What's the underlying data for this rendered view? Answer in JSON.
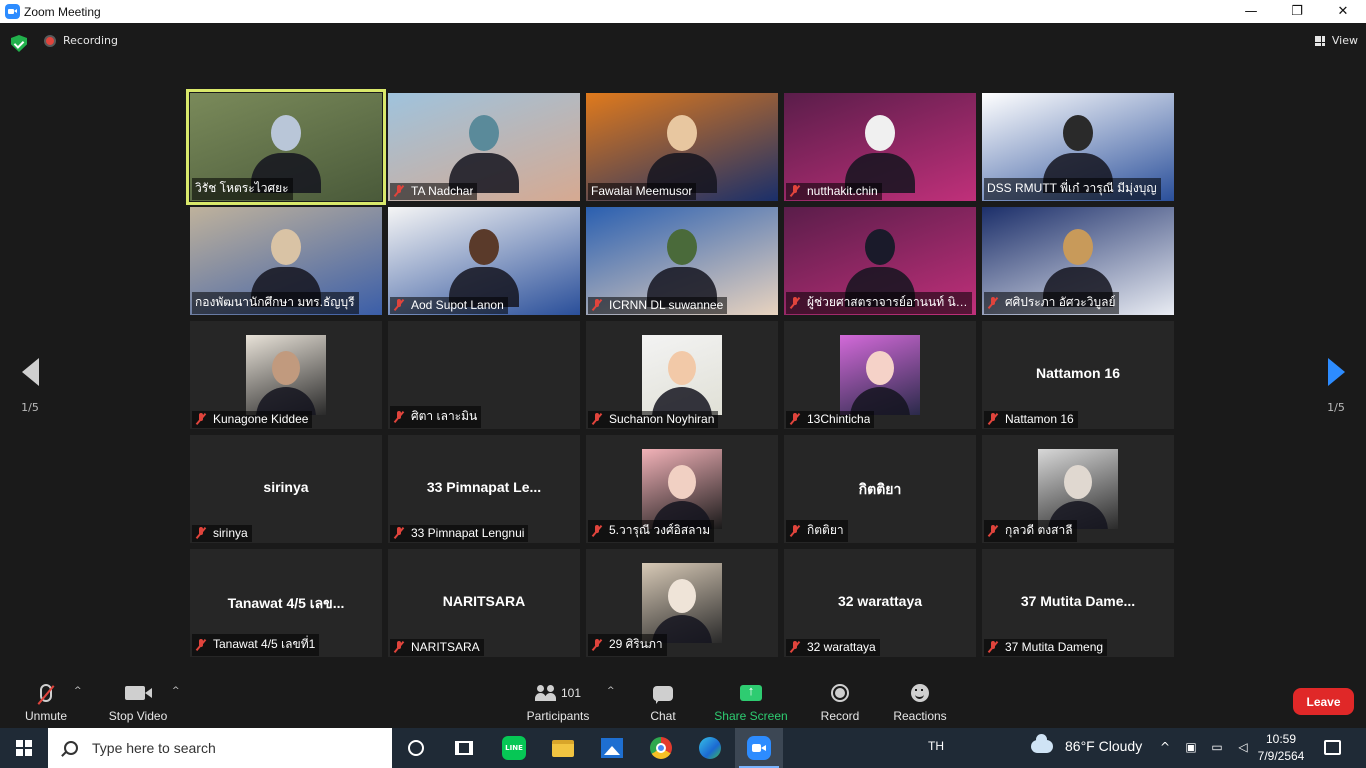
{
  "window": {
    "title": "Zoom Meeting",
    "minimize": "—",
    "restore": "❐",
    "close": "✕"
  },
  "topbar": {
    "recording_label": "Recording",
    "view_label": "View"
  },
  "paging": {
    "prev_label": "1/5",
    "next_label": "1/5"
  },
  "colors": {
    "accent": "#2d8cff",
    "active_speaker": "#d9e86b",
    "leave": "#e02828",
    "share": "#2ecc71",
    "muted": "#e0443c"
  },
  "participants": [
    {
      "name": "วิรัช  โหตระไวศยะ",
      "muted": false,
      "kind": "video",
      "palette": [
        "#7a8a5a",
        "#4a5a3a",
        "#b9c6d8"
      ],
      "active": true
    },
    {
      "name": "TA Nadchar",
      "muted": true,
      "kind": "video",
      "palette": [
        "#9fc3dd",
        "#d6a991",
        "#5a8a9a"
      ]
    },
    {
      "name": "Fawalai Meemusor",
      "muted": false,
      "kind": "video",
      "palette": [
        "#e07a1c",
        "#1a2f6a",
        "#e8c7a0"
      ]
    },
    {
      "name": "nutthakit.chin",
      "muted": true,
      "kind": "video",
      "palette": [
        "#5a1d4a",
        "#c0307a",
        "#f0f0f0"
      ]
    },
    {
      "name": "DSS RMUTT พี่เก๋ วารุณี มีมุ่งบุญ",
      "muted": false,
      "kind": "video",
      "palette": [
        "#ffffff",
        "#2a4f9a",
        "#2a2a2a"
      ]
    },
    {
      "name": "กองพัฒนานักศึกษา มทร.ธัญบุรี",
      "muted": false,
      "kind": "video",
      "palette": [
        "#bfb29c",
        "#3b5ea8",
        "#d9c3a5"
      ]
    },
    {
      "name": "Aod Supot Lanon",
      "muted": true,
      "kind": "video",
      "palette": [
        "#f5f5f5",
        "#2a4f9a",
        "#5a3a2a"
      ]
    },
    {
      "name": "ICRNN DL suwannee",
      "muted": true,
      "kind": "video",
      "palette": [
        "#2a5fb0",
        "#e8d3bf",
        "#4a6a3a"
      ]
    },
    {
      "name": "ผู้ช่วยศาสตราจารย์อานนท์ นิยม...",
      "muted": true,
      "kind": "video",
      "palette": [
        "#5a1d4a",
        "#c0307a",
        "#1a1a2a"
      ]
    },
    {
      "name": "ศศิประภา อัศวะวิบูลย์",
      "muted": true,
      "kind": "video",
      "palette": [
        "#1c2f6a",
        "#e9ecf3",
        "#c89a5a"
      ]
    },
    {
      "name": "Kunagone Kiddee",
      "muted": true,
      "kind": "photo",
      "palette": [
        "#e8e2d8",
        "#2a2a2a",
        "#c19a7e"
      ]
    },
    {
      "name": "ศิตา เลาะมิน",
      "muted": true,
      "kind": "blank"
    },
    {
      "name": "Suchanon Noyhiran",
      "muted": true,
      "kind": "photo",
      "palette": [
        "#f3f3f3",
        "#e0e0d6",
        "#f2c9a8"
      ]
    },
    {
      "name": "13Chinticha",
      "muted": true,
      "kind": "photo",
      "palette": [
        "#d36ad9",
        "#2a2a4a",
        "#f5d2c8"
      ]
    },
    {
      "name": "Nattamon 16",
      "muted": true,
      "kind": "text",
      "display": "Nattamon 16"
    },
    {
      "name": "sirinya",
      "muted": true,
      "kind": "text",
      "display": "sirinya"
    },
    {
      "name": "33 Pimnapat Lengnui",
      "muted": true,
      "kind": "text",
      "display": "33 Pimnapat Le..."
    },
    {
      "name": "5.วารุณี วงศ์อิสลาม",
      "muted": true,
      "kind": "photo",
      "palette": [
        "#f2b2b8",
        "#1a1a1a",
        "#f1d0c3"
      ]
    },
    {
      "name": "กิตติยา",
      "muted": true,
      "kind": "text",
      "display": "กิตติยา"
    },
    {
      "name": "กุลวดี ตงสาลี",
      "muted": true,
      "kind": "photo",
      "palette": [
        "#d8d8d8",
        "#2a2a2a",
        "#e0d8d0"
      ]
    },
    {
      "name": "Tanawat 4/5 เลขที่1",
      "muted": true,
      "kind": "text",
      "display": "Tanawat 4/5 เลข..."
    },
    {
      "name": "NARITSARA",
      "muted": true,
      "kind": "text",
      "display": "NARITSARA"
    },
    {
      "name": "29 ศิรินภา",
      "muted": true,
      "kind": "photo",
      "palette": [
        "#d7c9b6",
        "#2a2a2a",
        "#efe4d8"
      ]
    },
    {
      "name": "32 warattaya",
      "muted": true,
      "kind": "text",
      "display": "32 warattaya"
    },
    {
      "name": "37 Mutita Dameng",
      "muted": true,
      "kind": "text",
      "display": "37 Mutita Dame..."
    }
  ],
  "toolbar": {
    "unmute_label": "Unmute",
    "stop_video_label": "Stop Video",
    "participants_label": "Participants",
    "participants_count": "101",
    "chat_label": "Chat",
    "share_label": "Share Screen",
    "record_label": "Record",
    "reactions_label": "Reactions",
    "leave_label": "Leave",
    "caret": "^"
  },
  "taskbar": {
    "search_placeholder": "Type here to search",
    "line_label": "LINE",
    "language": "TH",
    "weather": "86°F  Cloudy",
    "time": "10:59",
    "date": "7/9/2564",
    "tray_chevron": "^",
    "tray_icons": [
      "meet-icon",
      "battery-icon",
      "volume-icon"
    ]
  }
}
